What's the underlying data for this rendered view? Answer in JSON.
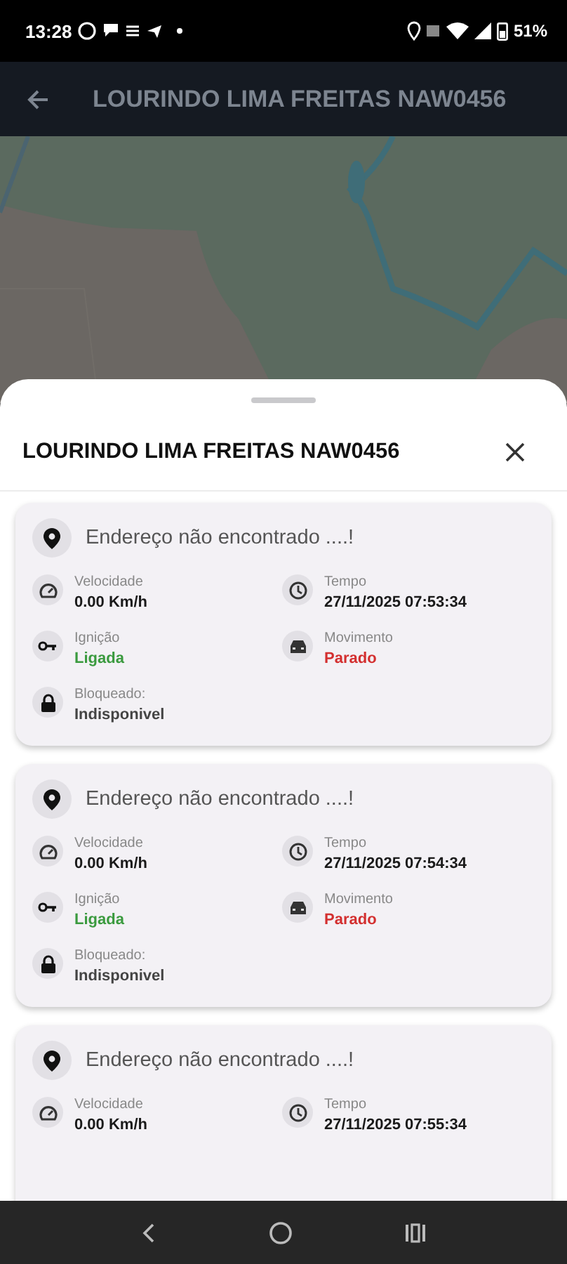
{
  "status_bar": {
    "time": "13:28",
    "battery": "51%"
  },
  "app_bar": {
    "title": "LOURINDO LIMA FREITAS NAW0456"
  },
  "sheet": {
    "title": "LOURINDO LIMA FREITAS NAW0456",
    "cards": [
      {
        "address": "Endereço não encontrado ....!",
        "fields": [
          {
            "kind": "speed",
            "label": "Velocidade",
            "value": "0.00 Km/h",
            "color": "#1a1a1a"
          },
          {
            "kind": "time",
            "label": "Tempo",
            "value": "27/11/2025 07:53:34",
            "color": "#1a1a1a"
          },
          {
            "kind": "ignition",
            "label": "Ignição",
            "value": "Ligada",
            "color": "#3a9a3e"
          },
          {
            "kind": "movement",
            "label": "Movimento",
            "value": "Parado",
            "color": "#d32f2f"
          },
          {
            "kind": "lock",
            "label": "Bloqueado:",
            "value": "Indisponivel",
            "color": "#444444"
          }
        ]
      },
      {
        "address": "Endereço não encontrado ....!",
        "fields": [
          {
            "kind": "speed",
            "label": "Velocidade",
            "value": "0.00 Km/h",
            "color": "#1a1a1a"
          },
          {
            "kind": "time",
            "label": "Tempo",
            "value": "27/11/2025 07:54:34",
            "color": "#1a1a1a"
          },
          {
            "kind": "ignition",
            "label": "Ignição",
            "value": "Ligada",
            "color": "#3a9a3e"
          },
          {
            "kind": "movement",
            "label": "Movimento",
            "value": "Parado",
            "color": "#d32f2f"
          },
          {
            "kind": "lock",
            "label": "Bloqueado:",
            "value": "Indisponivel",
            "color": "#444444"
          }
        ]
      },
      {
        "address": "Endereço não encontrado ....!",
        "fields": [
          {
            "kind": "speed",
            "label": "Velocidade",
            "value": "0.00 Km/h",
            "color": "#1a1a1a"
          },
          {
            "kind": "time",
            "label": "Tempo",
            "value": "27/11/2025 07:55:34",
            "color": "#1a1a1a"
          }
        ]
      }
    ]
  }
}
